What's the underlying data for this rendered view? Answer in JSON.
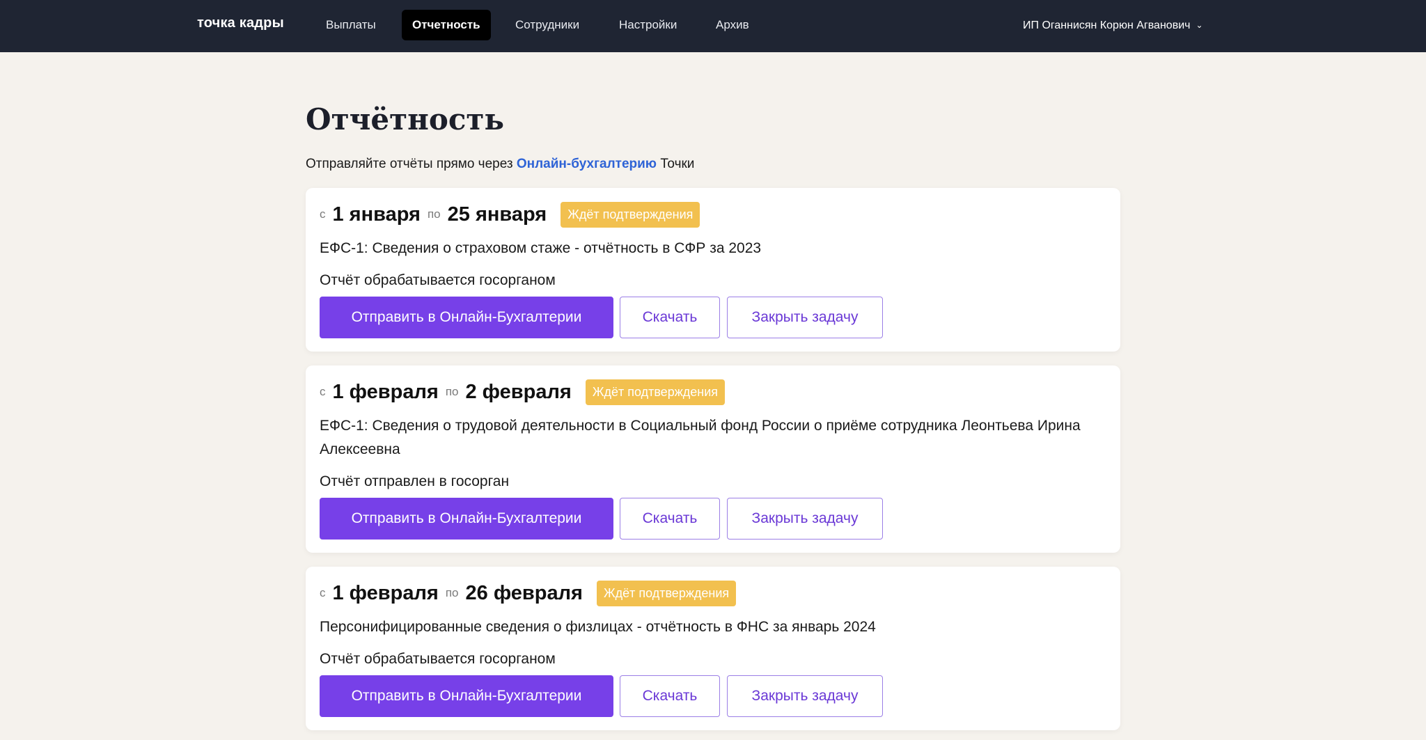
{
  "brand": "точка кадры",
  "nav": [
    {
      "label": "Выплаты"
    },
    {
      "label": "Отчетность"
    },
    {
      "label": "Сотрудники"
    },
    {
      "label": "Настройки"
    },
    {
      "label": "Архив"
    }
  ],
  "user": {
    "name": "ИП Оганнисян Корюн Агванович"
  },
  "page": {
    "title": "Отчётность",
    "subtitle_prefix": "Отправляйте отчёты прямо через",
    "subtitle_link": "Онлайн-бухгалтерию",
    "subtitle_suffix": "Точки"
  },
  "labels": {
    "from": "с",
    "to": "по",
    "send": "Отправить в Онлайн-Бухгалтерии",
    "download": "Скачать",
    "close": "Закрыть задачу"
  },
  "reports": [
    {
      "date_from": "1 января",
      "date_to": "25 января",
      "badge": "Ждёт подтверждения",
      "description": "ЕФС-1: Сведения о страховом стаже - отчётность в СФР за 2023",
      "status": "Отчёт обрабатывается госорганом"
    },
    {
      "date_from": "1 февраля",
      "date_to": "2 февраля",
      "badge": "Ждёт подтверждения",
      "description": "ЕФС-1: Сведения о трудовой деятельности в Социальный фонд России о приёме сотрудника Леонтьева Ирина Алексеевна",
      "status": "Отчёт отправлен в госорган"
    },
    {
      "date_from": "1 февраля",
      "date_to": "26 февраля",
      "badge": "Ждёт подтверждения",
      "description": "Персонифицированные сведения о физлицах - отчётность в ФНС за январь 2024",
      "status": "Отчёт обрабатывается госорганом"
    }
  ],
  "colors": {
    "topbar": "#1f2533",
    "background": "#f5f2ed",
    "primary": "#7740e8",
    "badge": "#f2c04f",
    "link": "#2e63d6"
  }
}
